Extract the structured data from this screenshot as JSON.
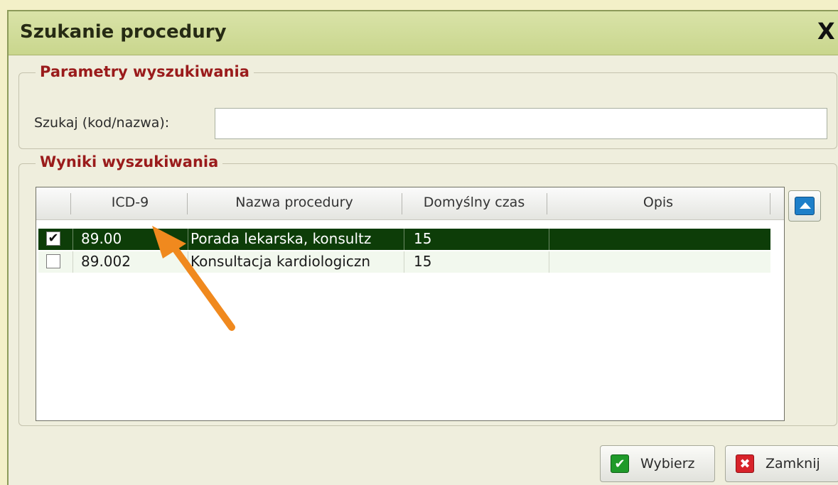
{
  "window": {
    "title": "Szukanie procedury",
    "close_glyph": "X"
  },
  "search_group": {
    "legend": "Parametry wyszukiwania",
    "label": "Szukaj (kod/nazwa):",
    "value": "",
    "placeholder": ""
  },
  "results_group": {
    "legend": "Wyniki wyszukiwania",
    "columns": [
      "ICD-9",
      "Nazwa procedury",
      "Domyślny czas",
      "Opis"
    ],
    "rows": [
      {
        "checked": true,
        "selected": true,
        "icd9": "89.00",
        "name": "Porada lekarska, konsultz",
        "time": "15",
        "desc": ""
      },
      {
        "checked": false,
        "selected": false,
        "icd9": "89.002",
        "name": "Konsultacja kardiologiczn",
        "time": "15",
        "desc": ""
      }
    ]
  },
  "buttons": {
    "select": "Wybierz",
    "close": "Zamknij"
  },
  "icons": {
    "select": "green-check-icon",
    "close": "red-x-icon",
    "scroll": "scroll-up-icon",
    "annotation": "orange-arrow-icon"
  },
  "colors": {
    "selected_row": "#0d3d08",
    "legend_text": "#9a1b1b",
    "annotation_arrow": "#f0891e"
  }
}
